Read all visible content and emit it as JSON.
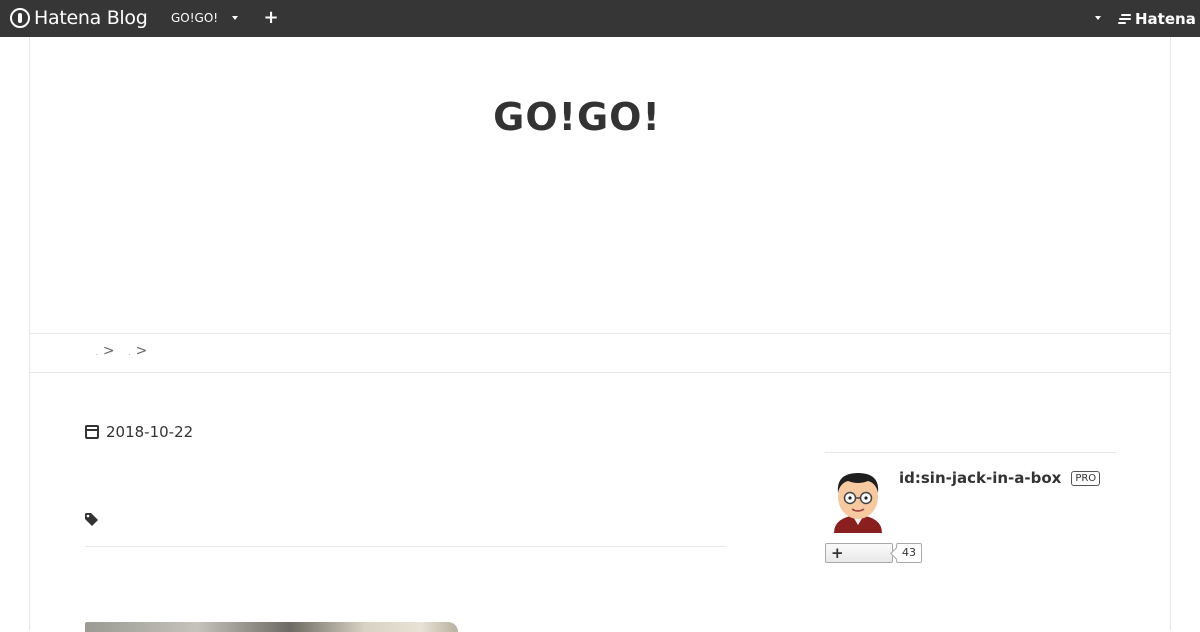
{
  "topbar": {
    "brand": "Hatena Blog",
    "blog_name": "GO!GO!",
    "new_entry_icon": "plus-icon",
    "hatena_label": "Hatena"
  },
  "blog": {
    "title": "GO!GO!"
  },
  "breadcrumb": {
    "separator": ">"
  },
  "entry": {
    "date": "2018-10-22"
  },
  "profile": {
    "id": "id:sin-jack-in-a-box",
    "badge": "PRO",
    "follow_icon": "plus-icon",
    "follower_count": "43"
  },
  "colors": {
    "topbar_bg": "#363636",
    "link": "#2a7ab0",
    "border": "#e6e6e6"
  }
}
